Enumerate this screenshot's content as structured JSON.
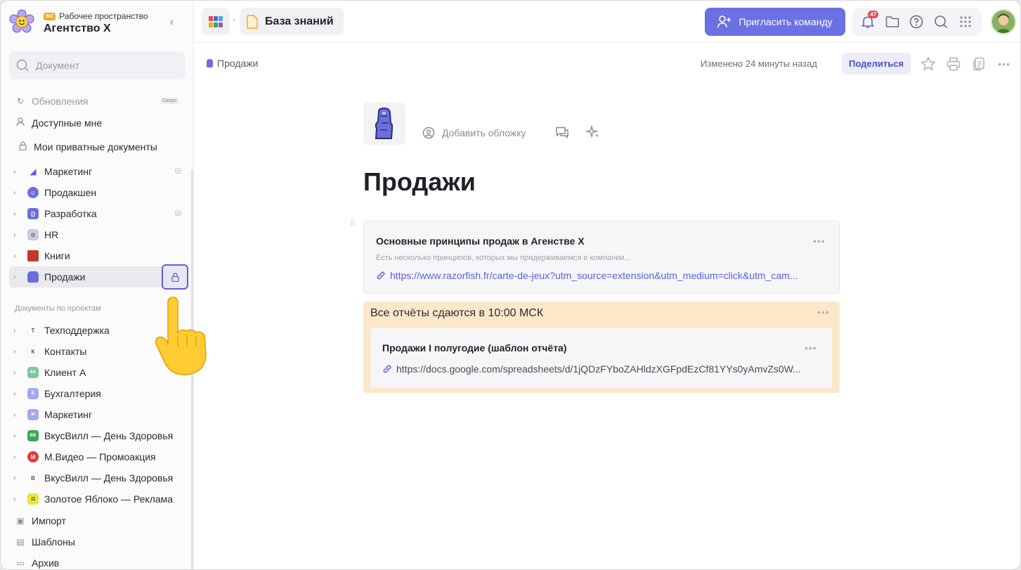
{
  "workspace": {
    "tag": "BIZ",
    "label": "Рабочее пространство",
    "name": "Агентство X"
  },
  "sidebar": {
    "search_placeholder": "Документ",
    "top_items": [
      {
        "label": "Обновления",
        "icon": "refresh-icon",
        "badge": "Скоро"
      },
      {
        "label": "Доступные мне",
        "icon": "user-icon"
      },
      {
        "label": "Мои приватные документы",
        "icon": "lock-icon"
      }
    ],
    "spaces": [
      {
        "label": "Маркетинг",
        "icon": "megaphone-icon",
        "color": "#5b5fd6",
        "shared": true
      },
      {
        "label": "Продакшен",
        "icon": "globe-icon",
        "color": "#6a6fdc"
      },
      {
        "label": "Разработка",
        "icon": "code-icon",
        "color": "#6a6fdc",
        "shared": true
      },
      {
        "label": "HR",
        "icon": "robot-icon",
        "color": "#9aa0c8"
      },
      {
        "label": "Книги",
        "icon": "book-icon",
        "color": "#c0392b"
      },
      {
        "label": "Продажи",
        "icon": "moai-icon",
        "color": "#6a6fdc",
        "active": true
      }
    ],
    "projects_title": "Документы по проектам",
    "projects": [
      {
        "label": "Техподдержка",
        "letter": "Т",
        "color": "#ffffff"
      },
      {
        "label": "Контакты",
        "letter": "К",
        "color": "#ffffff"
      },
      {
        "label": "Клиент А",
        "letter": "КА",
        "color": "#7cc9a0"
      },
      {
        "label": "Бухгалтерия",
        "letter": "Б",
        "color": "#a6a9ee"
      },
      {
        "label": "Маркетинг",
        "letter": "М",
        "color": "#a6a9ee"
      },
      {
        "label": "ВкусВилл — День Здоровья",
        "letter": "ВВ",
        "color": "#3aa655"
      },
      {
        "label": "М.Видео — Промоакция",
        "letter": "М",
        "color": "#e53935"
      },
      {
        "label": "ВкусВилл — День Здоровья",
        "letter": "В",
        "color": "#ffffff"
      },
      {
        "label": "Золотое Яблоко — Реклама",
        "letter": "Я",
        "color": "#f0e23a"
      }
    ],
    "bottom_items": [
      {
        "label": "Импорт",
        "icon": "import-icon"
      },
      {
        "label": "Шаблоны",
        "icon": "templates-icon"
      },
      {
        "label": "Архив",
        "icon": "archive-icon"
      }
    ]
  },
  "topbar": {
    "breadcrumb_label": "База знаний",
    "invite_label": "Пригласить команду",
    "notifications_count": "47"
  },
  "doc": {
    "breadcrumb": "Продажи",
    "changed": "Изменено 24 минуты назад",
    "share_label": "Поделиться",
    "add_cover": "Добавить обложку",
    "title": "Продажи",
    "card1": {
      "title": "Основные принципы продаж в Агенстве X",
      "desc": "Есть несколько принципов, которых мы придерживаемся в компании...",
      "link": "https://www.razorfish.fr/carte-de-jeux?utm_source=extension&utm_medium=click&utm_cam..."
    },
    "callout": {
      "text": "Все отчёты сдаются в 10:00 МСК",
      "card_title": "Продажи I полугодие (шаблон отчёта)",
      "card_link": "https://docs.google.com/spreadsheets/d/1jQDzFYboZAHldzXGFpdEzCf81YYs0yAmvZs0W..."
    }
  },
  "colors": {
    "accent": "#6b70e3",
    "callout_bg": "#fbe8c9",
    "link": "#5a62d8",
    "badge": "#e84a4a"
  }
}
